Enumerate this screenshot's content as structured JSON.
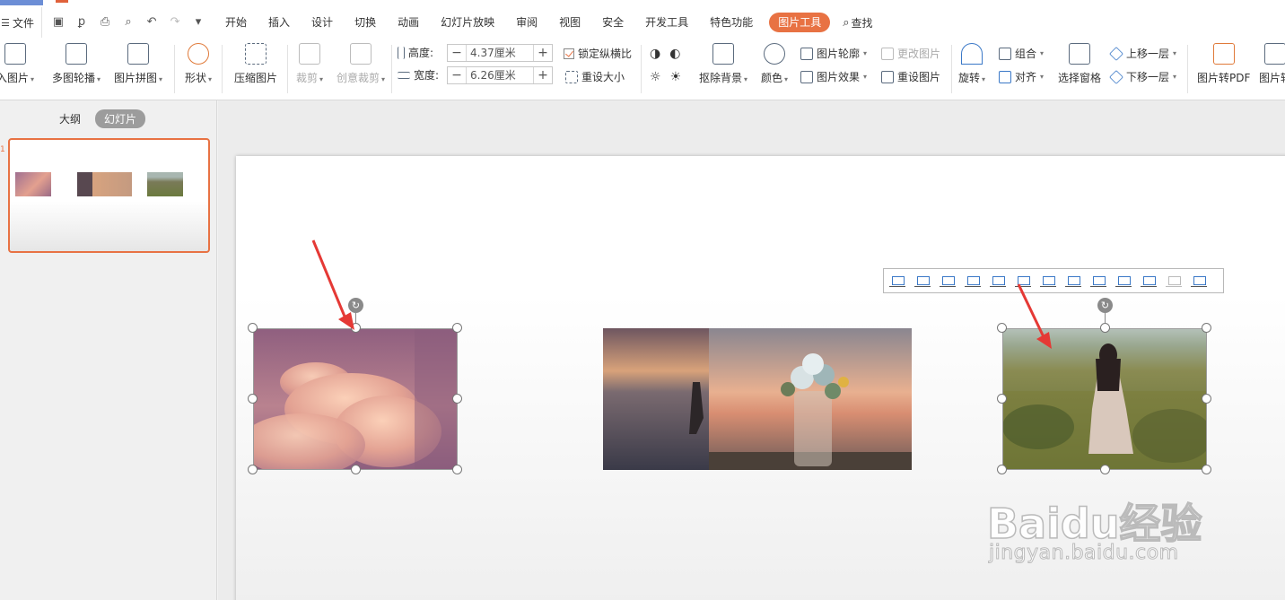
{
  "menubar": {
    "file_label": "文件",
    "tabs": [
      "开始",
      "插入",
      "设计",
      "切换",
      "动画",
      "幻灯片放映",
      "审阅",
      "视图",
      "安全",
      "开发工具",
      "特色功能"
    ],
    "active_tab": "图片工具",
    "search_label": "查找"
  },
  "ribbon": {
    "insert_picture": "入图片",
    "multi_carousel": "多图轮播",
    "picture_collage": "图片拼图",
    "shape": "形状",
    "compress_picture": "压缩图片",
    "crop": "裁剪",
    "creative_crop": "创意裁剪",
    "height_label": "高度:",
    "height_value": "4.37厘米",
    "width_label": "宽度:",
    "width_value": "6.26厘米",
    "lock_ratio": "锁定纵横比",
    "reset_size": "重设大小",
    "remove_background": "抠除背景",
    "color": "颜色",
    "picture_outline": "图片轮廓",
    "picture_effect": "图片效果",
    "change_picture": "更改图片",
    "reset_picture": "重设图片",
    "rotate": "旋转",
    "group": "组合",
    "align": "对齐",
    "selection_pane": "选择窗格",
    "bring_forward": "上移一层",
    "send_backward": "下移一层",
    "picture_to_pdf": "图片转PDF",
    "picture_to_more": "图片转"
  },
  "left_pane": {
    "tab_outline": "大纲",
    "tab_slides": "幻灯片",
    "slide_number": "1"
  },
  "watermark": {
    "brand": "Baidu经验",
    "url": "jingyan.baidu.com"
  },
  "colors": {
    "accent": "#e87243",
    "arrow": "#e53935",
    "selection_handle": "#ffffff"
  }
}
